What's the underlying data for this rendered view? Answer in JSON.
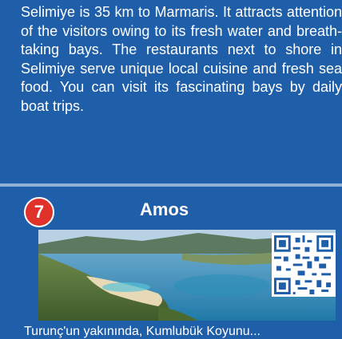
{
  "section": {
    "paragraph": "Selimiye is 35 km to Marmaris. It attracts attention of the visitors owing to its fresh water and breath-taking bays. The restaurants next to shore in Selimiye serve unique local cuisine and fresh sea food. You can visit its fascinating bays by daily boat trips."
  },
  "place": {
    "number": "7",
    "title": "Amos"
  },
  "next_text": "Turunç'un yakınında, Kumlubük Koyunu...",
  "colors": {
    "background": "#1f5ea8",
    "badge": "#e0322a",
    "divider": "#8fb0d8"
  },
  "icons": {
    "qr": "qr-code-icon"
  }
}
